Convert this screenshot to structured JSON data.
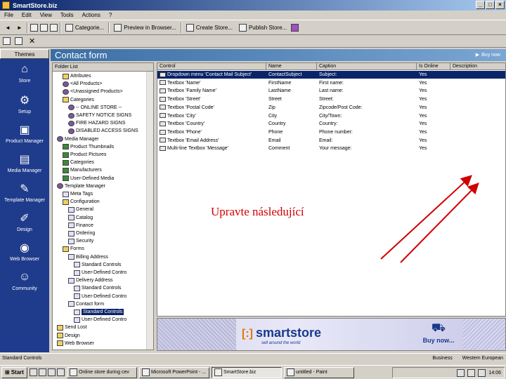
{
  "window": {
    "title": "SmartStore.biz",
    "buttons": [
      "_",
      "□",
      "×"
    ]
  },
  "menu": [
    "File",
    "Edit",
    "View",
    "Tools",
    "Actions",
    "?"
  ],
  "toolbar": {
    "buttons": [
      {
        "label": "Categorie...",
        "icon": "categories-icon"
      },
      {
        "label": "Preview in Browser...",
        "icon": "preview-icon"
      },
      {
        "label": "Create Store...",
        "icon": "create-store-icon"
      },
      {
        "label": "Publish Store...",
        "icon": "publish-icon"
      }
    ]
  },
  "themes": {
    "header": "Themes",
    "items": [
      {
        "label": "Store",
        "icon": "house-icon"
      },
      {
        "label": "Setup",
        "icon": "setup-icon"
      },
      {
        "label": "Product Manager",
        "icon": "product-manager-icon"
      },
      {
        "label": "Media Manager",
        "icon": "media-manager-icon"
      },
      {
        "label": "Template Manager",
        "icon": "template-manager-icon"
      },
      {
        "label": "Design",
        "icon": "design-icon"
      },
      {
        "label": "Web Browser",
        "icon": "globe-icon"
      },
      {
        "label": "Community",
        "icon": "community-icon"
      }
    ]
  },
  "content": {
    "title": "Contact form",
    "help": "Buy now"
  },
  "tree": {
    "header": "Folder List",
    "nodes": [
      {
        "label": "Attributes",
        "icon": "folder"
      },
      {
        "label": "<All Products>",
        "icon": "gear"
      },
      {
        "label": "<Unassigned Products>",
        "icon": "gear"
      },
      {
        "label": "Categories",
        "icon": "folder"
      },
      {
        "label": "-- ONLINE STORE --",
        "icon": "gear"
      },
      {
        "label": "SAFETY NOTICE SIGNS",
        "icon": "gear"
      },
      {
        "label": "FIRE HAZARD SIGNS",
        "icon": "gear"
      },
      {
        "label": "DISABLED ACCESS SIGNS",
        "icon": "gear"
      },
      {
        "label": "Media Manager",
        "icon": "gear"
      },
      {
        "label": "Product Thumbnails",
        "icon": "grid"
      },
      {
        "label": "Product Pictures",
        "icon": "grid"
      },
      {
        "label": "Categories",
        "icon": "grid"
      },
      {
        "label": "Manufacturers",
        "icon": "grid"
      },
      {
        "label": "User-Defined Media",
        "icon": "grid"
      },
      {
        "label": "Template Manager",
        "icon": "gear"
      },
      {
        "label": "Meta Tags",
        "icon": "page"
      },
      {
        "label": "Configuration",
        "icon": "folder"
      },
      {
        "label": "General",
        "icon": "page"
      },
      {
        "label": "Catalog",
        "icon": "page"
      },
      {
        "label": "Finance",
        "icon": "page"
      },
      {
        "label": "Ordering",
        "icon": "page"
      },
      {
        "label": "Security",
        "icon": "page"
      },
      {
        "label": "Forms",
        "icon": "folder"
      },
      {
        "label": "Billing Address",
        "icon": "page"
      },
      {
        "label": "Standard Controls",
        "icon": "page"
      },
      {
        "label": "User-Defined Contro",
        "icon": "page"
      },
      {
        "label": "Delivery Address",
        "icon": "page"
      },
      {
        "label": "Standard Controls",
        "icon": "page"
      },
      {
        "label": "User-Defined Contro",
        "icon": "page"
      },
      {
        "label": "Contact form",
        "icon": "page"
      },
      {
        "label": "Standard Controls",
        "icon": "page"
      },
      {
        "label": "User-Defined Contro",
        "icon": "page"
      },
      {
        "label": "Send Lost",
        "icon": "folder"
      },
      {
        "label": "Design",
        "icon": "folder"
      },
      {
        "label": "Web Browser",
        "icon": "folder"
      }
    ]
  },
  "grid": {
    "columns": [
      "Control",
      "Name",
      "Caption",
      "Is Online",
      "Description"
    ],
    "rows": [
      {
        "control": "Dropdown menu 'Contact Mail Subject'",
        "name": "ContactSubject",
        "caption": "Subject:",
        "online": "Yes",
        "selected": true
      },
      {
        "control": "Textbox 'Name'",
        "name": "FirstName",
        "caption": "First name:",
        "online": "Yes"
      },
      {
        "control": "Textbox 'Family Name'",
        "name": "LastName",
        "caption": "Last name:",
        "online": "Yes"
      },
      {
        "control": "Textbox 'Street'",
        "name": "Street",
        "caption": "Street:",
        "online": "Yes"
      },
      {
        "control": "Textbox 'Postal Code'",
        "name": "Zip",
        "caption": "Zipcode/Post Code:",
        "online": "Yes"
      },
      {
        "control": "Textbox 'City'",
        "name": "City",
        "caption": "City/Town:",
        "online": "Yes"
      },
      {
        "control": "Textbox 'Country'",
        "name": "Country",
        "caption": "Country:",
        "online": "Yes"
      },
      {
        "control": "Textbox 'Phone'",
        "name": "Phone",
        "caption": "Phone number:",
        "online": "Yes"
      },
      {
        "control": "Textbox 'Email Address'",
        "name": "Email",
        "caption": "Email:",
        "online": "Yes"
      },
      {
        "control": "Multi-line Textbox 'Message'",
        "name": "Comment",
        "caption": "Your message:",
        "online": "Yes"
      }
    ]
  },
  "annotation": {
    "text": "Upravte následující",
    "color": "#d00000"
  },
  "banner": {
    "mark": "[:]",
    "brand": "smartstore",
    "tagline": "sell around the world",
    "buy": "Buy now..."
  },
  "status": {
    "left": "Standard Controls",
    "business": "Business",
    "region": "Western European"
  },
  "taskbar": {
    "start": "Start",
    "tasks": [
      {
        "label": "Online store during cev",
        "active": false
      },
      {
        "label": "Microsoft PowerPoint - ...",
        "active": false
      },
      {
        "label": "SmartStore.biz",
        "active": true
      },
      {
        "label": "untitled - Paint",
        "active": false
      }
    ],
    "clock": "14:06"
  },
  "colors": {
    "title_bar": "#0a246a",
    "theme_panel": "#1f3c8c",
    "annotation": "#d00000"
  }
}
